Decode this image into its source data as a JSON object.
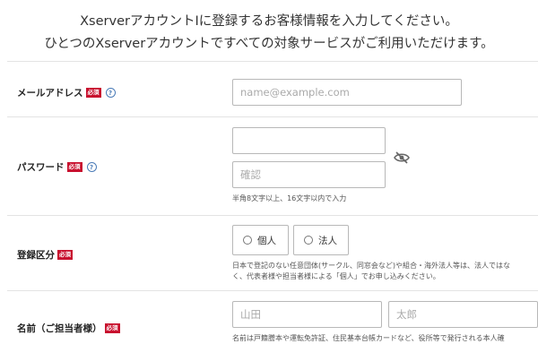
{
  "intro": {
    "line1": "XserverアカウントIに登録するお客様情報を入力してください。",
    "line2": "ひとつのXserverアカウントですべての対象サービスがご利用いただけます。"
  },
  "required_badge": "必須",
  "help_glyph": "?",
  "email": {
    "label": "メールアドレス",
    "placeholder": "name@example.com"
  },
  "password": {
    "label": "パスワード",
    "value": "",
    "confirm_placeholder": "確認",
    "hint": "半角8文字以上、16文字以内で入力"
  },
  "registration_type": {
    "label": "登録区分",
    "options": [
      "個人",
      "法人"
    ],
    "note_line1": "日本で登記のない任意団体(サークル、同窓会など)や組合・海外法人等は、法人ではな",
    "note_line2": "く、代表者様や担当者様による「個人」でお申し込みください。"
  },
  "name": {
    "label": "名前（ご担当者様）",
    "last_placeholder": "山田",
    "first_placeholder": "太郎",
    "note": "名前は戸籍謄本や運転免許証、住民基本台帳カードなど、役所等で発行される本人確"
  },
  "colors": {
    "required_red": "#c8102e",
    "help_blue": "#4a7bb7",
    "border": "#b8b8b8"
  },
  "icons": {
    "help": "question-circle-icon",
    "eye": "eye-slash-icon",
    "radio": "radio-circle-icon"
  }
}
